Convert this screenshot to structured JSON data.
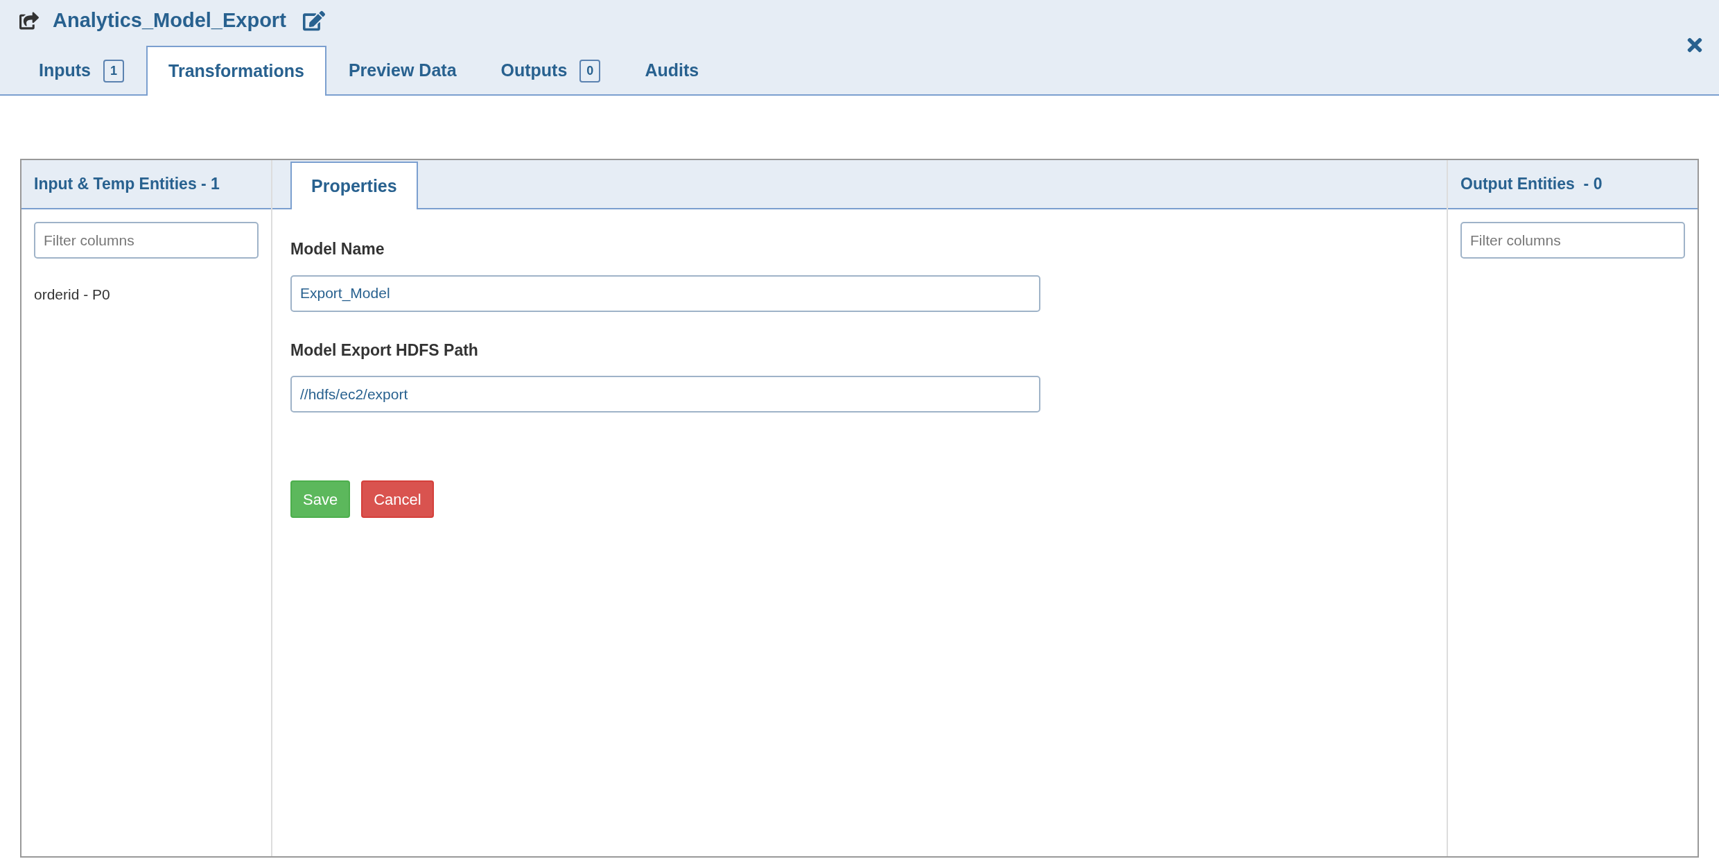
{
  "window": {
    "title": "Analytics_Model_Export"
  },
  "tabs": [
    {
      "label": "Inputs",
      "badge": "1",
      "selected": false
    },
    {
      "label": "Transformations",
      "selected": true
    },
    {
      "label": "Preview Data",
      "selected": false
    },
    {
      "label": "Outputs",
      "badge": "0",
      "selected": false
    },
    {
      "label": "Audits",
      "selected": false
    }
  ],
  "left_panel": {
    "title": "Input & Temp Entities - 1",
    "filter": {
      "placeholder": "Filter columns"
    },
    "items": [
      "orderid - P0"
    ]
  },
  "center_panel": {
    "tabs": [
      {
        "label": "Properties",
        "selected": true
      }
    ],
    "fields": [
      {
        "label": "Model Name",
        "value": "Export_Model"
      },
      {
        "label": "Model Export HDFS Path",
        "value": "//hdfs/ec2/export"
      }
    ],
    "buttons": [
      {
        "label": "Save",
        "kind": "success"
      },
      {
        "label": "Cancel",
        "kind": "danger"
      }
    ]
  },
  "right_panel": {
    "title": "Output Entities  - 0",
    "filter": {
      "placeholder": "Filter columns"
    }
  }
}
